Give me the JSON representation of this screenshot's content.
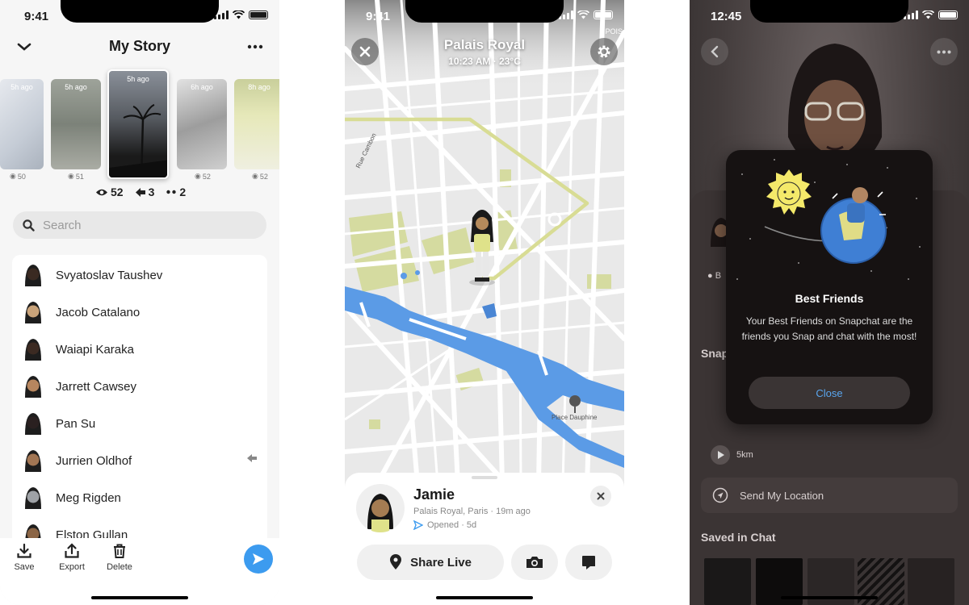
{
  "story_screen": {
    "status_time": "9:41",
    "title": "My Story",
    "thumbnails": [
      {
        "ago": "5h ago",
        "views": "50"
      },
      {
        "ago": "5h ago",
        "views": "51"
      },
      {
        "ago": "5h ago",
        "views": ""
      },
      {
        "ago": "6h ago",
        "views": "52"
      },
      {
        "ago": "8h ago",
        "views": "52"
      }
    ],
    "stats": {
      "views": "52",
      "screenshots": "3",
      "replies": "2"
    },
    "search": {
      "placeholder": "Search"
    },
    "friends": [
      {
        "name": "Svyatoslav Taushev",
        "ghost": false
      },
      {
        "name": "Jacob Catalano",
        "ghost": false
      },
      {
        "name": "Waiapi Karaka",
        "ghost": false
      },
      {
        "name": "Jarrett Cawsey",
        "ghost": false
      },
      {
        "name": "Pan Su",
        "ghost": false
      },
      {
        "name": "Jurrien Oldhof",
        "ghost": true
      },
      {
        "name": "Meg Rigden",
        "ghost": false
      },
      {
        "name": "Elston Gullan",
        "ghost": false
      }
    ],
    "actions": {
      "save": "Save",
      "export": "Export",
      "delete": "Delete"
    },
    "colors": {
      "accent": "#3c9bef"
    }
  },
  "map_screen": {
    "status_time": "9:41",
    "place": "Palais Royal",
    "subtitle": "10:23 AM · 23°C",
    "street_labels": {
      "rue": "Rue Cambon",
      "poi": "POIS",
      "place": "Place Dauphine"
    },
    "card": {
      "name": "Jamie",
      "location": "Palais Royal, Paris · 19m ago",
      "opened": "Opened · 5d",
      "share_live": "Share Live"
    },
    "colors": {
      "river": "#5b9be6",
      "route": "#d8dc94",
      "park": "#d5dba0"
    }
  },
  "friends_screen": {
    "status_time": "12:45",
    "modal": {
      "title": "Best Friends",
      "body": "Your Best Friends on Snapchat are the friends you Snap and chat with the most!",
      "close": "Close"
    },
    "partial_labels": {
      "b": "B",
      "snap": "Snap",
      "distance": "5km"
    },
    "send_location": "Send My Location",
    "saved_in_chat": "Saved in Chat"
  }
}
